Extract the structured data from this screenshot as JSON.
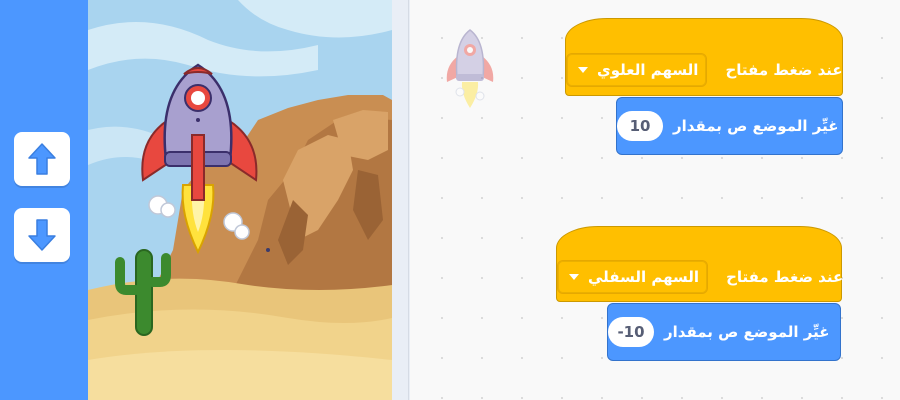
{
  "controls": {
    "up_arrow_icon": "arrow-up-icon",
    "down_arrow_icon": "arrow-down-icon"
  },
  "stage": {
    "sprite": "rocket",
    "backdrop": "desert"
  },
  "scripts": [
    {
      "hat_label": "عند ضغط مفتاح",
      "key_option": "السهم العلوي",
      "command_label": "غيِّر الموضع ص بمقدار",
      "value": "10"
    },
    {
      "hat_label": "عند ضغط مفتاح",
      "key_option": "السهم السفلي",
      "command_label": "غيِّر الموضع ص بمقدار",
      "value": "-10"
    }
  ],
  "colors": {
    "events": "#ffbf00",
    "motion": "#4c97ff",
    "accent": "#4c97ff"
  }
}
